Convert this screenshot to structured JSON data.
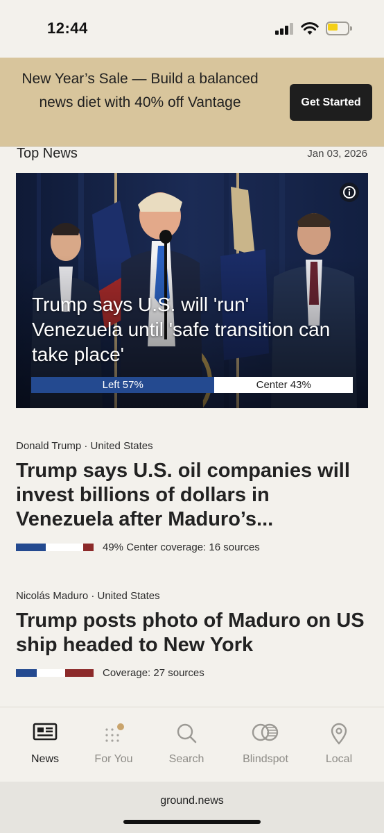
{
  "status_bar": {
    "time": "12:44"
  },
  "promo": {
    "text": "New Year’s Sale — Build a balanced news diet with 40% off Vantage",
    "button_label": "Get Started"
  },
  "section": {
    "title": "Top News",
    "date": "Jan 03, 2026"
  },
  "hero": {
    "headline": "Trump says U.S. will 'run' Venezuela until 'safe transition can take place'",
    "bias": [
      {
        "label": "Left 57%",
        "share": 0.57,
        "color": "#244a90"
      },
      {
        "label": "Center 43%",
        "share": 0.43,
        "color": "#ffffff"
      }
    ]
  },
  "stories": [
    {
      "meta": "Donald Trump · United States",
      "headline": "Trump says U.S. oil companies will invest billions of dollars in Venezuela after Maduro’s...",
      "coverage_text": "49% Center coverage: 16 sources",
      "coverage_bar": [
        {
          "share": 0.38,
          "color": "#244a90"
        },
        {
          "share": 0.49,
          "color": "#ffffff"
        },
        {
          "share": 0.13,
          "color": "#8c2a2a"
        }
      ]
    },
    {
      "meta": "Nicolás Maduro · United States",
      "headline": "Trump posts photo of Maduro on US ship headed to New York",
      "coverage_text": "Coverage: 27 sources",
      "coverage_bar": [
        {
          "share": 0.27,
          "color": "#244a90"
        },
        {
          "share": 0.36,
          "color": "#ffffff"
        },
        {
          "share": 0.37,
          "color": "#8c2a2a"
        }
      ]
    }
  ],
  "tabs": [
    {
      "label": "News",
      "icon": "newspaper-icon",
      "active": true
    },
    {
      "label": "For You",
      "icon": "dots-grid-icon",
      "active": false
    },
    {
      "label": "Search",
      "icon": "search-icon",
      "active": false
    },
    {
      "label": "Blindspot",
      "icon": "blindspot-icon",
      "active": false
    },
    {
      "label": "Local",
      "icon": "location-pin-icon",
      "active": false
    }
  ],
  "browser": {
    "url": "ground.news"
  }
}
